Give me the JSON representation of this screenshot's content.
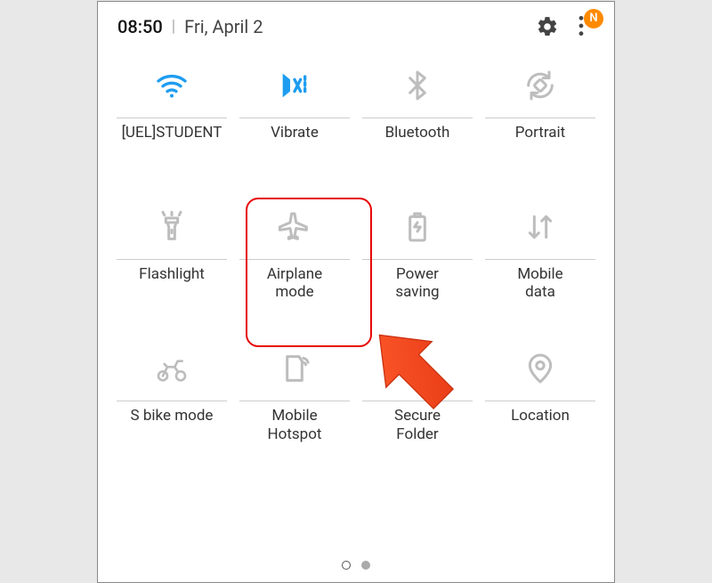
{
  "status": {
    "time": "08:50",
    "date": "Fri, April 2",
    "badge": "N"
  },
  "tiles": [
    {
      "id": "wifi",
      "label": "[UEL]STUDENT",
      "active": true
    },
    {
      "id": "vibrate",
      "label": "Vibrate",
      "active": true
    },
    {
      "id": "bluetooth",
      "label": "Bluetooth",
      "active": false
    },
    {
      "id": "portrait",
      "label": "Portrait",
      "active": false
    },
    {
      "id": "flashlight",
      "label": "Flashlight",
      "active": false
    },
    {
      "id": "airplane",
      "label": "Airplane\nmode",
      "active": false
    },
    {
      "id": "powersave",
      "label": "Power\nsaving",
      "active": false
    },
    {
      "id": "mobiledata",
      "label": "Mobile\ndata",
      "active": false
    },
    {
      "id": "sbike",
      "label": "S bike mode",
      "active": false
    },
    {
      "id": "hotspot",
      "label": "Mobile\nHotspot",
      "active": false
    },
    {
      "id": "secfolder",
      "label": "Secure\nFolder",
      "active": false
    },
    {
      "id": "location",
      "label": "Location",
      "active": false
    }
  ],
  "highlight_tile": "airplane",
  "colors": {
    "active": "#1e9df0",
    "inactive": "#bdbdbd",
    "highlight": "#e60000",
    "arrow": "#f44321",
    "badge": "#ff8a00"
  },
  "pager": {
    "total": 2,
    "current": 0
  }
}
